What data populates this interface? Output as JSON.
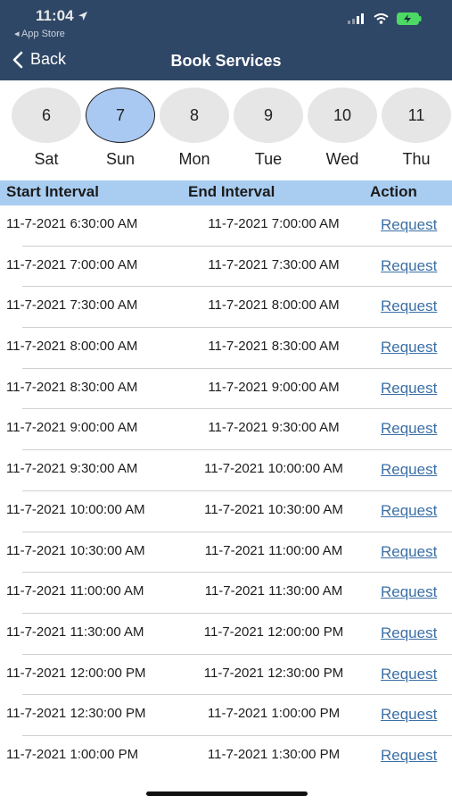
{
  "status_bar": {
    "time": "11:04",
    "back_app": "◂ App Store"
  },
  "nav": {
    "back_label": "Back",
    "title": "Book Services"
  },
  "days": [
    {
      "num": "6",
      "name": "Sat",
      "selected": false
    },
    {
      "num": "7",
      "name": "Sun",
      "selected": true
    },
    {
      "num": "8",
      "name": "Mon",
      "selected": false
    },
    {
      "num": "9",
      "name": "Tue",
      "selected": false
    },
    {
      "num": "10",
      "name": "Wed",
      "selected": false
    },
    {
      "num": "11",
      "name": "Thu",
      "selected": false
    }
  ],
  "table": {
    "headers": [
      "Start Interval",
      "End Interval",
      "Action"
    ],
    "rows": [
      {
        "start": "11-7-2021 6:30:00 AM",
        "end": "11-7-2021 7:00:00 AM",
        "action": "Request"
      },
      {
        "start": "11-7-2021 7:00:00 AM",
        "end": "11-7-2021 7:30:00 AM",
        "action": "Request"
      },
      {
        "start": "11-7-2021 7:30:00 AM",
        "end": "11-7-2021 8:00:00 AM",
        "action": "Request"
      },
      {
        "start": "11-7-2021 8:00:00 AM",
        "end": "11-7-2021 8:30:00 AM",
        "action": "Request"
      },
      {
        "start": "11-7-2021 8:30:00 AM",
        "end": "11-7-2021 9:00:00 AM",
        "action": "Request"
      },
      {
        "start": "11-7-2021 9:00:00 AM",
        "end": "11-7-2021 9:30:00 AM",
        "action": "Request"
      },
      {
        "start": "11-7-2021 9:30:00 AM",
        "end": "11-7-2021 10:00:00 AM",
        "action": "Request"
      },
      {
        "start": "11-7-2021 10:00:00 AM",
        "end": "11-7-2021 10:30:00 AM",
        "action": "Request"
      },
      {
        "start": "11-7-2021 10:30:00 AM",
        "end": "11-7-2021 11:00:00 AM",
        "action": "Request"
      },
      {
        "start": "11-7-2021 11:00:00 AM",
        "end": "11-7-2021 11:30:00 AM",
        "action": "Request"
      },
      {
        "start": "11-7-2021 11:30:00 AM",
        "end": "11-7-2021 12:00:00 PM",
        "action": "Request"
      },
      {
        "start": "11-7-2021 12:00:00 PM",
        "end": "11-7-2021 12:30:00 PM",
        "action": "Request"
      },
      {
        "start": "11-7-2021 12:30:00 PM",
        "end": "11-7-2021 1:00:00 PM",
        "action": "Request"
      },
      {
        "start": "11-7-2021 1:00:00 PM",
        "end": "11-7-2021 1:30:00 PM",
        "action": "Request"
      }
    ]
  },
  "colors": {
    "header_bg": "#2f4766",
    "selected_day": "#a9c9f2",
    "table_header_bg": "#a9cdf1",
    "link": "#3b6fa6",
    "battery": "#4cd964"
  },
  "icons": {
    "location": "location-arrow-icon",
    "signal": "cellular-signal-icon",
    "wifi": "wifi-icon",
    "battery": "battery-charging-icon",
    "back": "chevron-left-icon"
  }
}
